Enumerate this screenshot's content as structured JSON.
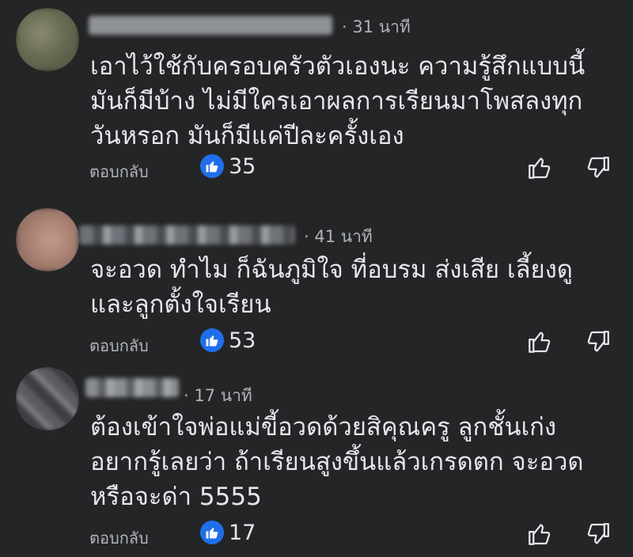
{
  "comments": [
    {
      "name": "Supitcha Chaowanaphat",
      "time": "· 31 นาที",
      "lines": [
        "เอาไว้ใช้กับครอบครัวตัวเองนะ  ความรู้สึกแบบนี้",
        "มันก็มีบ้าง  ไม่มีใครเอาผลการเรียนมาโพสลงทุก",
        "วันหรอก  มันก็มีแค่ปีละครั้งเอง"
      ],
      "reply_label": "ตอบกลับ",
      "like_count": "35"
    },
    {
      "name": "Anchalee Thanakit",
      "time": "· 41 นาที",
      "lines": [
        "จะอวด ทำไม ก็ฉันภูมิใจ ที่อบรม ส่งเสีย เลี้ยงดู",
        "และลูกตั้งใจเรียน"
      ],
      "reply_label": "ตอบกลับ",
      "like_count": "53"
    },
    {
      "name": "Pimchanok",
      "time": "· 17 นาที",
      "lines": [
        "ต้องเข้าใจพ่อแม่ขี้อวดด้วยสิคุณครู ลูกชั้นเก่ง",
        "อยากรู้เลยว่า ถ้าเรียนสูงขึ้นแล้วเกรดตก จะอวด",
        "หรือจะด่า 5555"
      ],
      "reply_label": "ตอบกลับ",
      "like_count": "17"
    }
  ],
  "icons": {
    "like_badge": "like-icon",
    "thumbs_up": "thumbs-up-icon",
    "thumbs_down": "thumbs-down-icon"
  },
  "colors": {
    "background": "#242526",
    "text": "#e4e6eb",
    "secondary_text": "#b0b3b8",
    "like_blue": "#1f6feb"
  }
}
